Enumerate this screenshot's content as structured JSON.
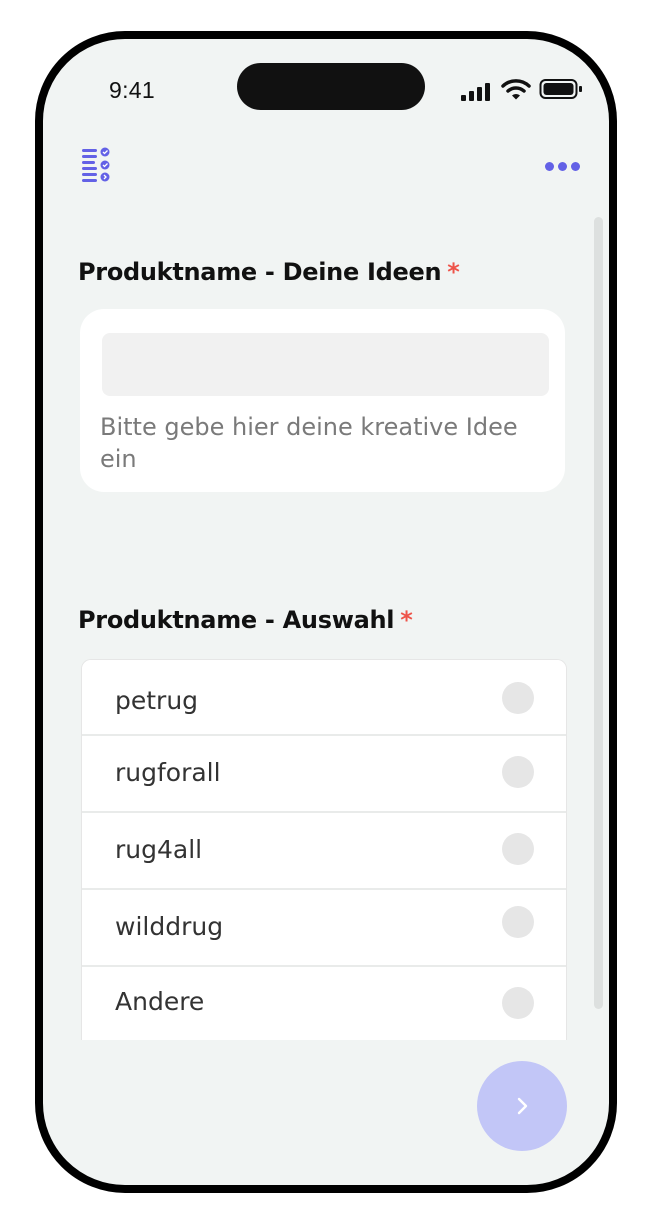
{
  "status_bar": {
    "time": "9:41",
    "icons": [
      "cellular-signal-icon",
      "wifi-icon",
      "battery-icon"
    ]
  },
  "header": {
    "left_icon": "checklist-icon",
    "right_icon": "more-options-icon"
  },
  "section_ideas": {
    "title": "Produktname - Deine Ideen",
    "required_mark": "*",
    "input_value": "",
    "hint": "Bitte gebe hier deine kreative Idee ein"
  },
  "section_choice": {
    "title": "Produktname - Auswahl",
    "required_mark": "*",
    "options": [
      {
        "label": "petrug",
        "selected": false
      },
      {
        "label": "rugforall",
        "selected": false
      },
      {
        "label": "rug4all",
        "selected": false
      },
      {
        "label": "wilddrug",
        "selected": false
      },
      {
        "label": "Andere",
        "selected": false
      }
    ]
  },
  "next_button": {
    "icon": "chevron-right-icon"
  },
  "colors": {
    "accent": "#6361e6",
    "required": "#ee5349",
    "background": "#f1f4f3",
    "next_button": "#c2c6f7"
  }
}
